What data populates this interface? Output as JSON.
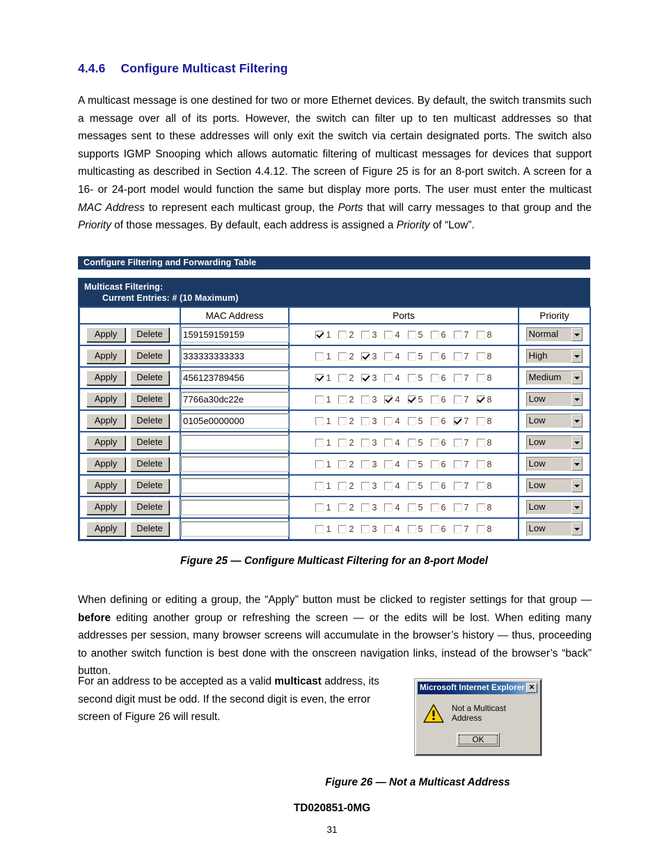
{
  "section": {
    "number": "4.4.6",
    "title": "Configure Multicast Filtering"
  },
  "paragraphs": {
    "intro_1": "A multicast message is one destined for two or more Ethernet devices.  By default, the switch transmits such a message over all of its ports.  However, the switch can filter up to ten multicast addresses so that messages sent to these addresses will only exit the switch via certain designated ports.  The switch also supports IGMP Snooping which allows automatic filtering of multicast messages for devices that support multicasting as described in Section 4.4.12.  The screen of Figure 25 is for an 8-port switch.  A screen for a 16- or 24-port model would function the same but display more ports.  The user must enter the multicast ",
    "intro_em1": "MAC Address",
    "intro_2": " to represent each multicast group, the ",
    "intro_em2": "Ports",
    "intro_3": " that will carry messages to that group and the ",
    "intro_em3": "Priority",
    "intro_4": " of those messages.  By default, each address is assigned a ",
    "intro_em4": "Priority",
    "intro_5": " of “Low”.",
    "apply_1": "When defining or editing a group, the “Apply” button must be clicked to register settings for that group — ",
    "apply_bold": "before",
    "apply_2": " editing another group or refreshing the screen — or the edits will be lost.  When editing many addresses per session, many browser screens will accumulate in the browser’s history — thus, proceeding to another switch function is best done with the onscreen navigation links, instead of the browser’s “back” button.",
    "valid_1": "For an address to be accepted as a valid ",
    "valid_bold": "multicast",
    "valid_2": " address, its second digit must be odd.  If the second digit is even, the error screen of Figure 26 will result."
  },
  "screenshot": {
    "window_title": "Configure Filtering and Forwarding Table",
    "panel_title": "Multicast Filtering:",
    "panel_subtitle": "Current Entries: # (10 Maximum)",
    "columns": {
      "actions": "",
      "mac": "MAC Address",
      "ports": "Ports",
      "priority": "Priority"
    },
    "buttons": {
      "apply": "Apply",
      "delete": "Delete"
    },
    "mac_placeholder": "",
    "port_labels": [
      "1",
      "2",
      "3",
      "4",
      "5",
      "6",
      "7",
      "8"
    ],
    "priority_options": [
      "Low",
      "Medium",
      "Normal",
      "High"
    ],
    "rows": [
      {
        "mac": "159159159159",
        "ports": [
          true,
          false,
          false,
          false,
          false,
          false,
          false,
          false
        ],
        "priority": "Normal"
      },
      {
        "mac": "333333333333",
        "ports": [
          false,
          false,
          true,
          false,
          false,
          false,
          false,
          false
        ],
        "priority": "High"
      },
      {
        "mac": "456123789456",
        "ports": [
          true,
          false,
          true,
          false,
          false,
          false,
          false,
          false
        ],
        "priority": "Medium"
      },
      {
        "mac": "7766a30dc22e",
        "ports": [
          false,
          false,
          false,
          true,
          true,
          false,
          false,
          true
        ],
        "priority": "Low"
      },
      {
        "mac": "0105e0000000",
        "ports": [
          false,
          false,
          false,
          false,
          false,
          false,
          true,
          false
        ],
        "priority": "Low"
      },
      {
        "mac": "",
        "ports": [
          false,
          false,
          false,
          false,
          false,
          false,
          false,
          false
        ],
        "priority": "Low"
      },
      {
        "mac": "",
        "ports": [
          false,
          false,
          false,
          false,
          false,
          false,
          false,
          false
        ],
        "priority": "Low"
      },
      {
        "mac": "",
        "ports": [
          false,
          false,
          false,
          false,
          false,
          false,
          false,
          false
        ],
        "priority": "Low"
      },
      {
        "mac": "",
        "ports": [
          false,
          false,
          false,
          false,
          false,
          false,
          false,
          false
        ],
        "priority": "Low"
      },
      {
        "mac": "",
        "ports": [
          false,
          false,
          false,
          false,
          false,
          false,
          false,
          false
        ],
        "priority": "Low"
      }
    ]
  },
  "figure_25_caption": "Figure 25 — Configure Multicast Filtering for an 8-port Model",
  "figure_26_caption": "Figure 26 — Not a Multicast Address",
  "dialog": {
    "title": "Microsoft Internet Explorer",
    "close_label": "✕",
    "message": "Not a Multicast Address",
    "ok_label": "OK",
    "icon": "warning-icon"
  },
  "footer": {
    "doc_id": "TD020851-0MG",
    "page_number": "31"
  },
  "colors": {
    "heading": "#17179c",
    "panel_navy": "#1b3a63",
    "table_border": "#2d5490",
    "button_face": "#d4d0c8",
    "dialog_title_start": "#0a246a",
    "dialog_title_end": "#a6c8e8",
    "port_label": "#5a3316"
  }
}
